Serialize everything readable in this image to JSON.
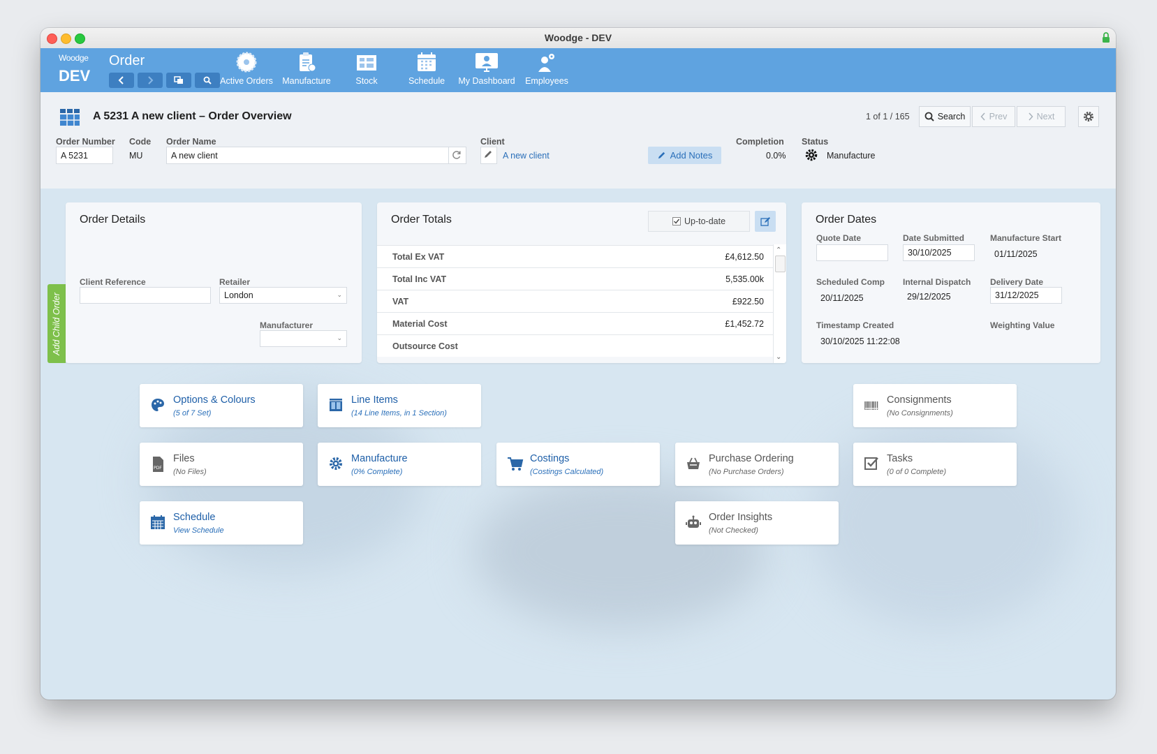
{
  "window": {
    "title": "Woodge - DEV"
  },
  "toolbar": {
    "logo_small": "Woodge",
    "logo_big": "DEV",
    "section": "Order",
    "tools": [
      {
        "label": "Active Orders",
        "icon": "saw-blade-icon"
      },
      {
        "label": "Manufacture",
        "icon": "clipboard-icon"
      },
      {
        "label": "Stock",
        "icon": "warehouse-icon"
      },
      {
        "label": "Schedule",
        "icon": "calendar-icon"
      },
      {
        "label": "My Dashboard",
        "icon": "monitor-user-icon"
      },
      {
        "label": "Employees",
        "icon": "employees-icon"
      }
    ]
  },
  "header": {
    "title": "A 5231 A new client – Order Overview",
    "record_count": "1 of 1 / 165",
    "search_label": "Search",
    "prev_label": "Prev",
    "next_label": "Next",
    "fields": {
      "order_number_label": "Order Number",
      "order_number": "A 5231",
      "code_label": "Code",
      "code": "MU",
      "order_name_label": "Order Name",
      "order_name": "A new client",
      "client_label": "Client",
      "client": "A new client",
      "add_notes": "Add Notes",
      "completion_label": "Completion",
      "completion": "0.0%",
      "status_label": "Status",
      "status": "Manufacture"
    }
  },
  "order_details": {
    "title": "Order Details",
    "client_reference_label": "Client Reference",
    "client_reference": "",
    "retailer_label": "Retailer",
    "retailer": "London",
    "manufacturer_label": "Manufacturer",
    "manufacturer": "",
    "child_tab": "Add Child Order"
  },
  "order_totals": {
    "title": "Order Totals",
    "up_to_date": "Up-to-date",
    "rows": [
      {
        "label": "Total Ex VAT",
        "value": "£4,612.50"
      },
      {
        "label": "Total Inc VAT",
        "value": "5,535.00k"
      },
      {
        "label": "VAT",
        "value": "£922.50"
      },
      {
        "label": "Material Cost",
        "value": "£1,452.72"
      },
      {
        "label": "Outsource Cost",
        "value": ""
      }
    ]
  },
  "order_dates": {
    "title": "Order Dates",
    "quote_date_label": "Quote Date",
    "quote_date": "",
    "date_submitted_label": "Date Submitted",
    "date_submitted": "30/10/2025",
    "manufacture_start_label": "Manufacture Start",
    "manufacture_start": "01/11/2025",
    "scheduled_comp_label": "Scheduled Comp",
    "scheduled_comp": "20/11/2025",
    "internal_dispatch_label": "Internal Dispatch",
    "internal_dispatch": "29/12/2025",
    "delivery_date_label": "Delivery Date",
    "delivery_date": "31/12/2025",
    "timestamp_created_label": "Timestamp Created",
    "timestamp_created": "30/10/2025 11:22:08",
    "weighting_value_label": "Weighting Value"
  },
  "tiles": [
    {
      "title": "Options & Colours",
      "sub": "(5 of 7 Set)",
      "icon": "palette-icon"
    },
    {
      "title": "Line Items",
      "sub": "(14 Line Items, in 1 Section)",
      "icon": "line-items-icon"
    },
    {
      "title": "Consignments",
      "sub": "(No Consignments)",
      "icon": "barcode-icon"
    },
    {
      "title": "Files",
      "sub": "(No Files)",
      "icon": "pdf-file-icon"
    },
    {
      "title": "Manufacture",
      "sub": "(0% Complete)",
      "icon": "gear-icon"
    },
    {
      "title": "Costings",
      "sub": "(Costings Calculated)",
      "icon": "cart-icon"
    },
    {
      "title": "Purchase Ordering",
      "sub": "(No Purchase Orders)",
      "icon": "basket-icon"
    },
    {
      "title": "Tasks",
      "sub": "(0 of 0 Complete)",
      "icon": "checkbox-icon"
    },
    {
      "title": "Schedule",
      "sub": "View Schedule",
      "icon": "calendar-icon"
    },
    {
      "title": "Order Insights",
      "sub": "(Not Checked)",
      "icon": "robot-icon"
    }
  ],
  "colors": {
    "toolbar": "#5fa3e0",
    "accent": "#2a6fb9",
    "child_tab": "#7ec04b"
  }
}
